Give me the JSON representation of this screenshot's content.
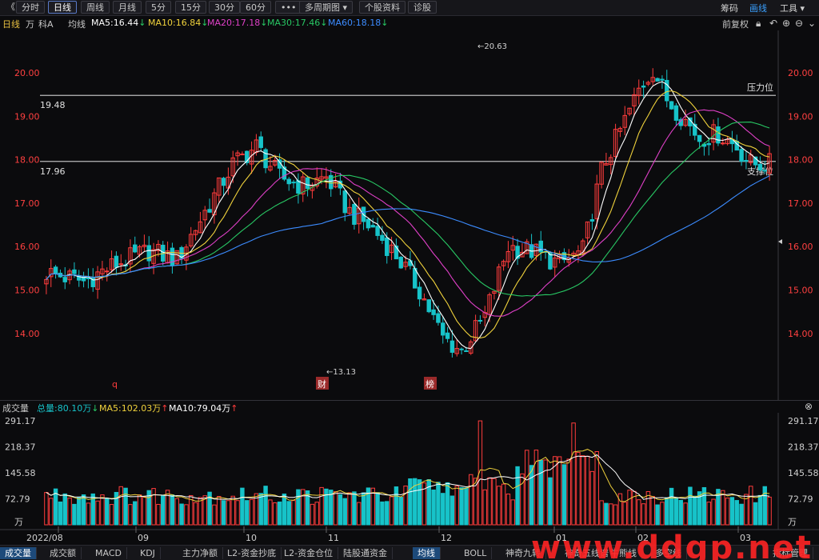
{
  "toolbar": {
    "back": "《",
    "buttons": [
      "分时",
      "日线",
      "周线",
      "月线",
      "5分",
      "15分",
      "30分",
      "60分",
      "•••",
      "多周期图 ▾",
      "个股资料",
      "诊股"
    ],
    "active": "日线",
    "right": [
      "筹码",
      "画线",
      "工具 ▾"
    ]
  },
  "infobar": {
    "period": "日线",
    "unit": "万",
    "stock": "科A",
    "ma_label": "均线",
    "ma5": "MA5:16.44",
    "ma10": "MA10:16.84",
    "ma20": "MA20:17.18",
    "ma30": "MA30:17.46",
    "ma60": "MA60:18.18",
    "fq": "前复权"
  },
  "colors": {
    "up": "#ff3c3c",
    "down": "#17c3c9",
    "ma5": "#ffffff",
    "ma10": "#f0d23c",
    "ma20": "#e040c8",
    "ma30": "#28c864",
    "ma60": "#3c8cff",
    "price_axis": "#ff4040"
  },
  "price_panel": {
    "y_labels": [
      "20.00",
      "19.00",
      "18.00",
      "17.00",
      "16.00",
      "15.00",
      "14.00"
    ],
    "resistance_value": "19.48",
    "resistance_label": "压力位",
    "support_value": "17.96",
    "support_label": "支撑位",
    "high_label": "20.63",
    "low_label": "13.13",
    "event_marks": [
      "q",
      "财",
      "榜"
    ]
  },
  "volume_bar": {
    "title": "成交量",
    "total": "总量:80.10万",
    "ma5": "MA5:102.03万",
    "ma10": "MA10:79.04万"
  },
  "volume_panel": {
    "y_labels": [
      "291.17",
      "218.37",
      "145.58",
      "72.79"
    ],
    "unit": "万"
  },
  "x_axis": [
    "2022/08",
    "09",
    "10",
    "11",
    "12",
    "01",
    "02",
    "03"
  ],
  "bottom_tabs": [
    "成交量",
    "成交额",
    "MACD",
    "KDJ",
    "主力净额",
    "L2-资金抄底",
    "L2-资金仓位",
    "陆股通资金",
    "均线",
    "BOLL",
    "神奇九转",
    "神奇五线谱",
    "牛熊线",
    "多空线",
    "指标管理"
  ],
  "bottom_active": [
    "成交量",
    "均线"
  ],
  "watermark": "www.ddgp.net",
  "chart_data": {
    "type": "candlestick",
    "title": "",
    "price_ylim": [
      13.1,
      20.9
    ],
    "volume_ylim": [
      0,
      300
    ],
    "series": [
      {
        "name": "MA5",
        "values": [
          16.44
        ]
      },
      {
        "name": "MA10",
        "values": [
          16.84
        ]
      },
      {
        "name": "MA20",
        "values": [
          17.18
        ]
      },
      {
        "name": "MA30",
        "values": [
          17.46
        ]
      },
      {
        "name": "MA60",
        "values": [
          18.18
        ]
      }
    ],
    "horizontal_lines": [
      19.48,
      17.96
    ],
    "high": 20.63,
    "low": 13.13
  }
}
